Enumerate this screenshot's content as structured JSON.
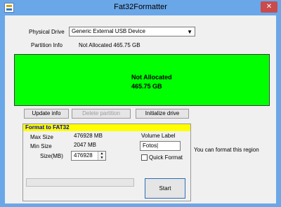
{
  "window": {
    "title": "Fat32Formatter",
    "close_glyph": "✕",
    "icon": "app-icon"
  },
  "drive": {
    "physical_drive_label": "Physical Drive",
    "selected_drive": "Generic External USB Device",
    "partition_info_label": "Partition Info",
    "partition_info_value": "Not Allocated   465.75 GB"
  },
  "partition_map": {
    "status": "Not Allocated",
    "size": "465.75 GB",
    "color": "#00ff00"
  },
  "buttons": {
    "update_info": "Update info",
    "delete_partition": "Delete partition",
    "initialize_drive": "Initialize drive",
    "start": "Start"
  },
  "format_panel": {
    "title": "Format to FAT32",
    "max_size_label": "Max Size",
    "max_size_value": "476928 MB",
    "min_size_label": "Min Size",
    "min_size_value": "2047 MB",
    "size_label": "Size(MB)",
    "size_value": "476928",
    "volume_label_label": "Volume Label",
    "volume_label_value": "Fotos|",
    "quick_format_label": "Quick Format",
    "quick_format_checked": false
  },
  "hint": "You can format this region",
  "progress": 0
}
